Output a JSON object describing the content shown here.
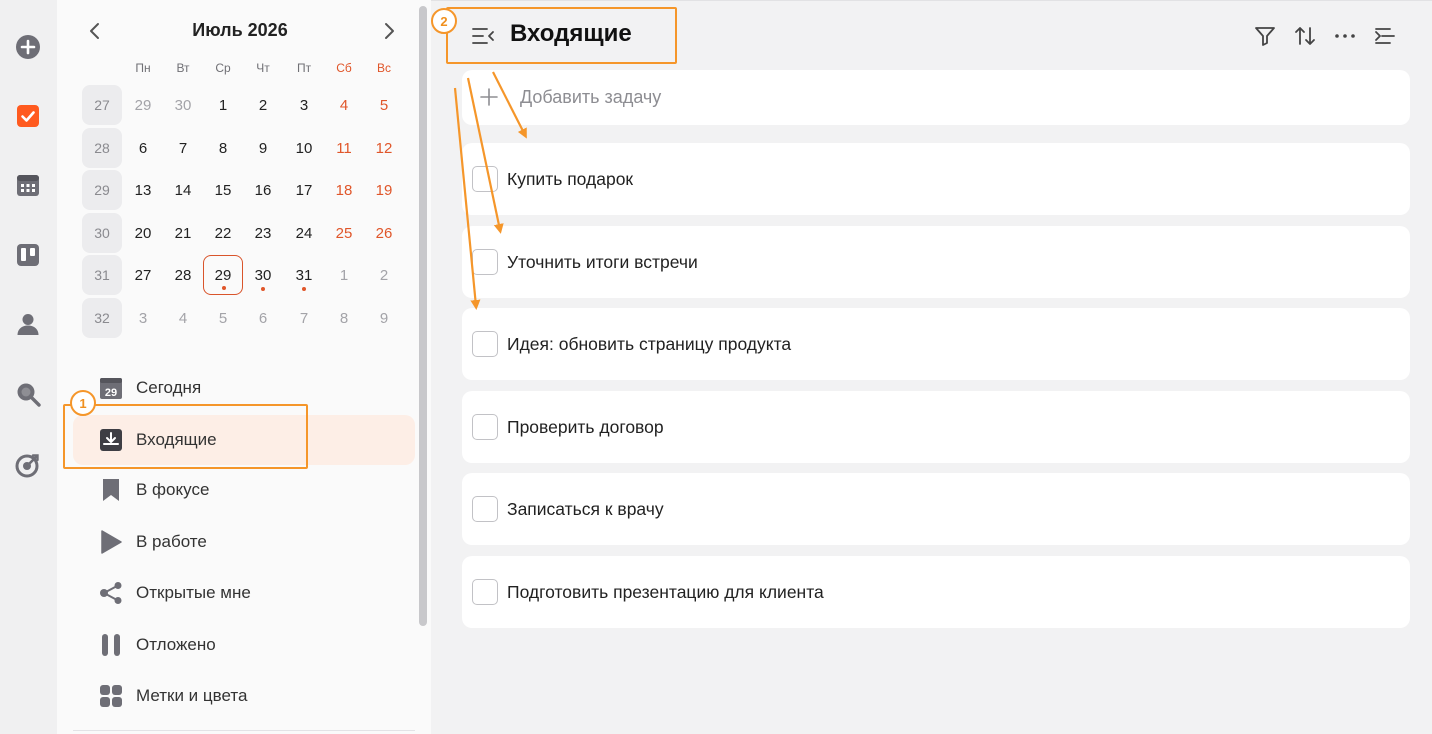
{
  "rail": {
    "icons": [
      "add-icon",
      "checkbox-icon",
      "calendar-icon",
      "kanban-icon",
      "user-icon",
      "search-icon",
      "target-icon"
    ],
    "accent": "#ff5a1f"
  },
  "calendar": {
    "title": "Июль 2026",
    "weekdays": [
      "Пн",
      "Вт",
      "Ср",
      "Чт",
      "Пт",
      "Сб",
      "Вс"
    ],
    "weeks": [
      {
        "num": "27",
        "days": [
          "29",
          "30",
          "1",
          "2",
          "3",
          "4",
          "5"
        ]
      },
      {
        "num": "28",
        "days": [
          "6",
          "7",
          "8",
          "9",
          "10",
          "11",
          "12"
        ]
      },
      {
        "num": "29",
        "days": [
          "13",
          "14",
          "15",
          "16",
          "17",
          "18",
          "19"
        ]
      },
      {
        "num": "30",
        "days": [
          "20",
          "21",
          "22",
          "23",
          "24",
          "25",
          "26"
        ]
      },
      {
        "num": "31",
        "days": [
          "27",
          "28",
          "29",
          "30",
          "31",
          "1",
          "2"
        ]
      },
      {
        "num": "32",
        "days": [
          "3",
          "4",
          "5",
          "6",
          "7",
          "8",
          "9"
        ]
      }
    ],
    "today": "29",
    "weekend_color": "#e0562a"
  },
  "nav": {
    "items": [
      {
        "label": "Сегодня",
        "icon": "calendar-day-icon",
        "badge": "29"
      },
      {
        "label": "Входящие",
        "icon": "inbox-icon"
      },
      {
        "label": "В фокусе",
        "icon": "bookmark-icon"
      },
      {
        "label": "В работе",
        "icon": "play-icon"
      },
      {
        "label": "Открытые мне",
        "icon": "share-icon"
      },
      {
        "label": "Отложено",
        "icon": "pause-icon"
      },
      {
        "label": "Метки и цвета",
        "icon": "tags-icon"
      }
    ]
  },
  "main": {
    "title": "Входящие",
    "add_placeholder": "Добавить задачу",
    "tasks": [
      {
        "label": "Купить подарок"
      },
      {
        "label": "Уточнить итоги встречи"
      },
      {
        "label": "Идея: обновить страницу продукта"
      },
      {
        "label": "Проверить договор"
      },
      {
        "label": "Записаться к врачу"
      },
      {
        "label": "Подготовить презентацию для клиента"
      }
    ]
  },
  "annotations": {
    "badge1": "1",
    "badge2": "2",
    "color": "#f5962a"
  }
}
